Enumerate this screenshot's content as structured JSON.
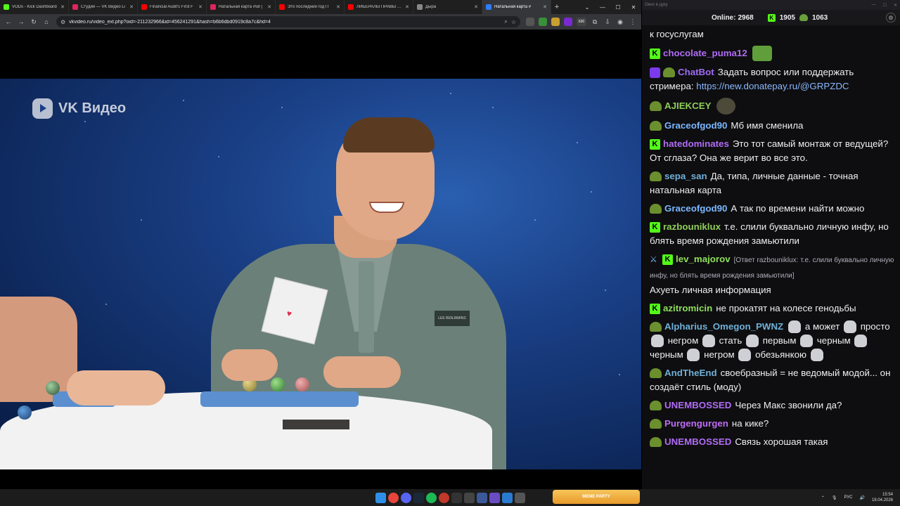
{
  "browser": {
    "tabs": [
      {
        "title": "VODs - Kick Dashboard",
        "color": "#53fc18"
      },
      {
        "title": "Студия — VK Видео Li",
        "color": "#e0245e"
      },
      {
        "title": "Financial Audit's First F",
        "color": "#ff0000"
      },
      {
        "title": "Натальная карта #58 |",
        "color": "#e0245e"
      },
      {
        "title": "Это последний год П",
        "color": "#ff0000"
      },
      {
        "title": "ЛИБЕРАЛЫ ПРАВЫ ВО",
        "color": "#ff0000"
      },
      {
        "title": "Дыра",
        "color": "#888888"
      },
      {
        "title": "Натальная карта #",
        "color": "#2d7ff9",
        "active": true
      }
    ],
    "url": "vkvideo.ru/video_ext.php?oid=-211232966&id=456241291&hash=b6b6dbd0919c8a7c&hd=4",
    "extension_badge": "630"
  },
  "video": {
    "watermark": "VK Видео",
    "badge_text": "LEE BENJAMINS"
  },
  "chat": {
    "window_title": "Окно в дуку",
    "online_label": "Online:",
    "online_count": "2968",
    "kick_count": "1905",
    "sub_count": "1063",
    "messages": [
      {
        "badges": [],
        "user": "",
        "color": "#efeff1",
        "text": "к госуслугам"
      },
      {
        "badges": [
          "kick"
        ],
        "user": "chocolate_puma12",
        "color": "#b06cf5",
        "text": "",
        "emote": "pepe"
      },
      {
        "badges": [
          "bot",
          "sub"
        ],
        "user": "ChatBot",
        "color": "#a06cf5",
        "text": "Задать вопрос или поддержать стримера:",
        "link": "https://new.donatepay.ru/@GRPZDC"
      },
      {
        "badges": [
          "sub"
        ],
        "user": "AJIEKCEY",
        "color": "#8fce5a",
        "text": "",
        "emote": "seal"
      },
      {
        "badges": [
          "sub"
        ],
        "user": "Graceofgod90",
        "color": "#7ab8ff",
        "text": "Мб имя сменила"
      },
      {
        "badges": [
          "kick"
        ],
        "user": "hatedominates",
        "color": "#b06cf5",
        "text": "Это тот самый монтаж от ведущей? От сглаза? Она же верит во все это."
      },
      {
        "badges": [
          "sub"
        ],
        "user": "sepa_san",
        "color": "#6fb0d8",
        "text": "Да, типа, личные данные - точная натальная карта"
      },
      {
        "badges": [
          "sub"
        ],
        "user": "Graceofgod90",
        "color": "#7ab8ff",
        "text": "А так по времени найти можно"
      },
      {
        "badges": [
          "kick"
        ],
        "user": "razbouniklux",
        "color": "#8fce5a",
        "text": "т.е. слили буквально личную инфу, но блять время рождения замьютили"
      },
      {
        "badges": [
          "sword",
          "kick"
        ],
        "user": "lev_majorov",
        "color": "#8fe05a",
        "reply": "[Ответ razbouniklux: т.е. слили буквально личную инфу, но блять время рождения замьютили]",
        "text": "Ахуеть личная информация"
      },
      {
        "badges": [
          "kick"
        ],
        "user": "azitromicin",
        "color": "#8fe05a",
        "text": "не прокатят на колесе генодьбы"
      },
      {
        "badges": [
          "sub"
        ],
        "user": "Alpharius_Omegon_PWNZ",
        "color": "#6fb0d8",
        "parts": [
          "",
          "dog",
          " а может ",
          "dog",
          " просто ",
          "dog",
          " негром ",
          "dog",
          " стать ",
          "dog",
          " первым ",
          "dog",
          " черным ",
          "dog",
          " черным ",
          "dog",
          " негром ",
          "dog",
          " обезьянкою ",
          "dog"
        ]
      },
      {
        "badges": [
          "sub"
        ],
        "user": "AndTheEnd",
        "color": "#6fb0d8",
        "text": "своебразный = не ведомый модой... он создаёт стиль (моду)"
      },
      {
        "badges": [
          "sub"
        ],
        "user": "UNEMBOSSED",
        "color": "#b06cf5",
        "text": "Через Макс звонили да?"
      },
      {
        "badges": [
          "sub"
        ],
        "user": "Purgengurgen",
        "color": "#c06cf5",
        "text": "на кике?"
      },
      {
        "badges": [
          "sub"
        ],
        "user": "UNEMBOSSED",
        "color": "#b06cf5",
        "text": "Связь хорошая такая"
      }
    ]
  },
  "taskbar": {
    "meme_label": "MEME PARTY",
    "lang": "РУС",
    "time": "15:54",
    "date": "19.04.2026"
  }
}
